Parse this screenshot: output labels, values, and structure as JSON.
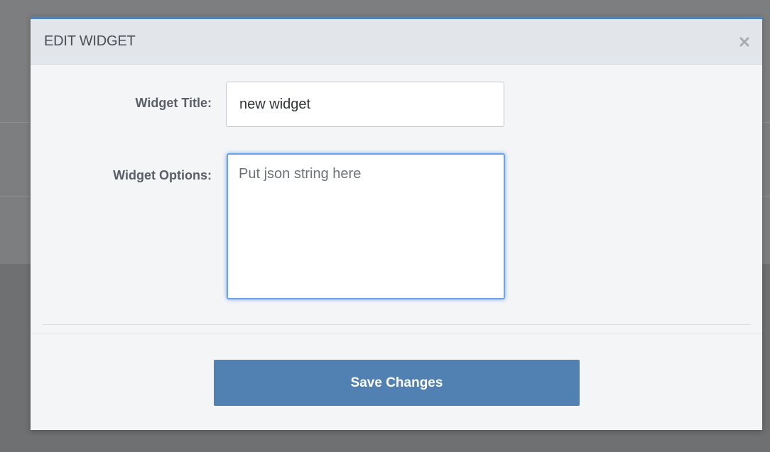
{
  "modal": {
    "title": "EDIT WIDGET",
    "close_icon": "close-icon"
  },
  "form": {
    "title_label": "Widget Title:",
    "title_value": "new widget",
    "options_label": "Widget Options:",
    "options_value": "",
    "options_placeholder": "Put json string here"
  },
  "footer": {
    "save_label": "Save Changes"
  },
  "colors": {
    "accent": "#5083b8",
    "button": "#5081b2",
    "focus_ring": "#6aa3ea"
  }
}
